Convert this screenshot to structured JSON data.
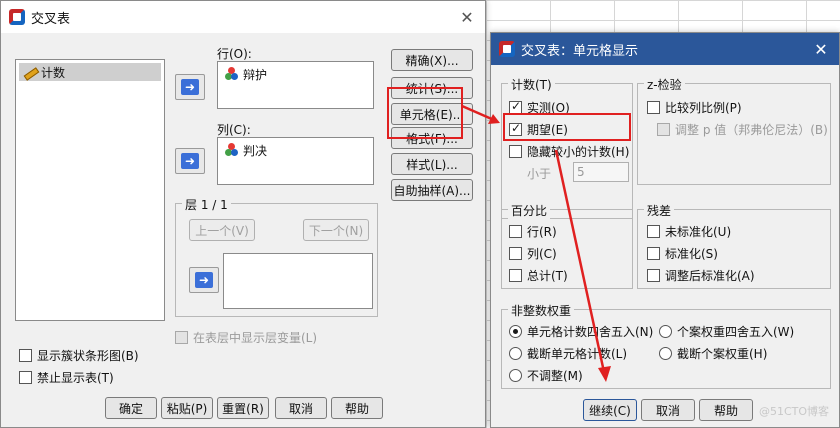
{
  "main_dialog": {
    "title": "交叉表",
    "variable_list": [
      {
        "label": "计数",
        "icon": "pencil-icon"
      }
    ],
    "row_label": "行(O):",
    "row_items": [
      {
        "label": "辩护",
        "icon": "nominal-icon"
      }
    ],
    "column_label": "列(C):",
    "column_items": [
      {
        "label": "判决",
        "icon": "nominal-icon"
      }
    ],
    "layer_group": "层 1 / 1",
    "prev_button": "上一个(V)",
    "next_button": "下一个(N)",
    "side_buttons": {
      "exact": "精确(X)...",
      "statistics": "统计(S)...",
      "cells": "单元格(E)...",
      "format": "格式(F)...",
      "style": "样式(L)...",
      "bootstrap": "自助抽样(A)..."
    },
    "show_layer_vars": "在表层中显示层变量(L)",
    "clustered_bar": "显示簇状条形图(B)",
    "suppress_tables": "禁止显示表(T)",
    "bottom_buttons": {
      "ok": "确定",
      "paste": "粘贴(P)",
      "reset": "重置(R)",
      "cancel": "取消",
      "help": "帮助"
    }
  },
  "cell_dialog": {
    "title": "交叉表：单元格显示",
    "counts": {
      "title": "计数(T)",
      "observed": "实测(O)",
      "expected": "期望(E)",
      "hide_small": "隐藏较小的计数(H)",
      "less_than": "小于",
      "less_than_value": "5"
    },
    "z_test": {
      "title": "z-检验",
      "compare": "比较列比例(P)",
      "adjust": "调整 p 值（邦弗伦尼法）(B)"
    },
    "percentages": {
      "title": "百分比",
      "row": "行(R)",
      "column": "列(C)",
      "total": "总计(T)"
    },
    "residuals": {
      "title": "残差",
      "unstandardized": "未标准化(U)",
      "standardized": "标准化(S)",
      "adjusted": "调整后标准化(A)"
    },
    "noninteger": {
      "title": "非整数权重",
      "round_cell": "单元格计数四舍五入(N)",
      "round_case": "个案权重四舍五入(W)",
      "truncate_cell": "截断单元格计数(L)",
      "truncate_case": "截断个案权重(H)",
      "no_adjust": "不调整(M)"
    },
    "buttons": {
      "continue": "继续(C)",
      "cancel": "取消",
      "help": "帮助"
    },
    "watermark": "@51CTO博客"
  },
  "colors": {
    "highlight": "#e02020",
    "title_bar": "#2b579a",
    "arrow_button": "#3b6fd8"
  }
}
